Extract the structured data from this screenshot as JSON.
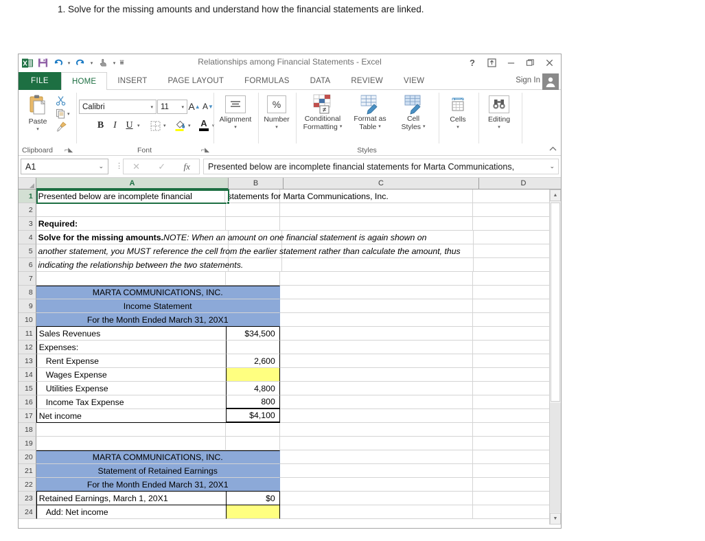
{
  "page": {
    "instruction": "1. Solve for the missing amounts and understand how the financial statements are linked."
  },
  "window": {
    "title": "Relationships among Financial Statements - Excel",
    "qat": [
      {
        "name": "excel-logo-icon",
        "glyph": "X"
      },
      {
        "name": "save-icon",
        "glyph": "💾"
      },
      {
        "name": "undo-icon",
        "glyph": "↶"
      },
      {
        "name": "redo-icon",
        "glyph": "↷"
      },
      {
        "name": "touch-mode-icon",
        "glyph": "☝"
      },
      {
        "name": "customize-qat-icon",
        "glyph": "⨍"
      }
    ],
    "controls": [
      {
        "name": "help-button",
        "glyph": "?"
      },
      {
        "name": "ribbon-display-options-button",
        "glyph": "⤒"
      },
      {
        "name": "minimize-button",
        "glyph": "—"
      },
      {
        "name": "restore-button",
        "glyph": "❐"
      },
      {
        "name": "close-button",
        "glyph": "✕"
      }
    ]
  },
  "ribbon": {
    "file_tab": "FILE",
    "tabs": [
      {
        "label": "HOME",
        "active": true
      },
      {
        "label": "INSERT",
        "active": false
      },
      {
        "label": "PAGE LAYOUT",
        "active": false
      },
      {
        "label": "FORMULAS",
        "active": false
      },
      {
        "label": "DATA",
        "active": false
      },
      {
        "label": "REVIEW",
        "active": false
      },
      {
        "label": "VIEW",
        "active": false
      }
    ],
    "sign_in": "Sign In",
    "groups": {
      "clipboard": {
        "label": "Clipboard",
        "paste": "Paste",
        "cut_icon": "scissors-icon",
        "copy_icon": "copy-icon",
        "format_painter_icon": "format-painter-icon"
      },
      "font": {
        "label": "Font",
        "font_name": "Calibri",
        "font_size": "11",
        "grow_font": "A",
        "shrink_font": "A",
        "bold": "B",
        "italic": "I",
        "underline": "U",
        "borders_icon": "borders-icon",
        "fill_color_icon": "fill-color-icon",
        "font_color": "A"
      },
      "alignment": {
        "label": "Alignment",
        "icon": "alignment-icon"
      },
      "number": {
        "label": "Number",
        "icon": "percent-icon",
        "glyph": "%"
      },
      "styles": {
        "label": "Styles",
        "conditional_formatting": "Conditional\nFormatting",
        "conditional_formatting_l1": "Conditional",
        "conditional_formatting_l2": "Formatting",
        "format_as_table_l1": "Format as",
        "format_as_table_l2": "Table",
        "cell_styles_l1": "Cell",
        "cell_styles_l2": "Styles"
      },
      "cells": {
        "label": "Cells",
        "icon": "cells-icon"
      },
      "editing": {
        "label": "Editing",
        "icon": "binoculars-icon"
      }
    },
    "collapse_icon": "chevron-up-icon"
  },
  "formula_bar": {
    "name_box_value": "A1",
    "cancel_icon": "cancel-icon",
    "enter_icon": "check-icon",
    "insert_function_icon": "fx-icon",
    "insert_function_label": "fx",
    "formula_value": "Presented below are incomplete financial statements for Marta Communications,",
    "expand_icon": "chevron-down-icon"
  },
  "grid": {
    "columns": [
      "A",
      "B",
      "C",
      "D"
    ],
    "selected_column": "A",
    "selected_row": 1,
    "rows": [
      {
        "n": 1,
        "cells": [
          {
            "col": "A",
            "text": "Presented below are incomplete financial",
            "overflow": true,
            "style": "plain"
          },
          {
            "col": "B",
            "text": "statements for Marta Communications, Inc.",
            "style": "overflowtext"
          },
          {
            "col": "C",
            "text": ""
          },
          {
            "col": "D",
            "text": ""
          }
        ]
      },
      {
        "n": 2,
        "cells": [
          {
            "col": "A",
            "text": ""
          },
          {
            "col": "B",
            "text": ""
          },
          {
            "col": "C",
            "text": ""
          },
          {
            "col": "D",
            "text": ""
          }
        ]
      },
      {
        "n": 3,
        "cells": [
          {
            "col": "A",
            "text": "Required:",
            "style": "bold"
          },
          {
            "col": "B",
            "text": ""
          },
          {
            "col": "C",
            "text": ""
          },
          {
            "col": "D",
            "text": ""
          }
        ]
      },
      {
        "n": 4,
        "cells": [
          {
            "col": "A",
            "text": "Solve for the missing amounts.",
            "text2": "  NOTE:  When an amount on one financial statement is again shown on",
            "style": "bold-then-italic",
            "overflow": true
          },
          {
            "col": "B",
            "text": ""
          },
          {
            "col": "C",
            "text": ""
          },
          {
            "col": "D",
            "text": ""
          }
        ]
      },
      {
        "n": 5,
        "cells": [
          {
            "col": "A",
            "text": "another statement, you MUST reference the cell from the earlier statement rather than calculate the amount, thus",
            "style": "italic",
            "overflow": true
          },
          {
            "col": "B",
            "text": ""
          },
          {
            "col": "C",
            "text": ""
          },
          {
            "col": "D",
            "text": ""
          }
        ]
      },
      {
        "n": 6,
        "cells": [
          {
            "col": "A",
            "text": "indicating the relationship between the two statements.",
            "style": "italic",
            "overflow": true
          },
          {
            "col": "B",
            "text": ""
          },
          {
            "col": "C",
            "text": ""
          },
          {
            "col": "D",
            "text": ""
          }
        ]
      },
      {
        "n": 7,
        "cells": [
          {
            "col": "A",
            "text": ""
          },
          {
            "col": "B",
            "text": ""
          },
          {
            "col": "C",
            "text": ""
          },
          {
            "col": "D",
            "text": ""
          }
        ]
      },
      {
        "n": 8,
        "cells": [
          {
            "col": "A",
            "text": "MARTA COMMUNICATIONS, INC.",
            "style": "blue-merged"
          },
          {
            "col": "C",
            "text": ""
          },
          {
            "col": "D",
            "text": ""
          }
        ]
      },
      {
        "n": 9,
        "cells": [
          {
            "col": "A",
            "text": "Income Statement",
            "style": "blue-merged"
          },
          {
            "col": "C",
            "text": ""
          },
          {
            "col": "D",
            "text": ""
          }
        ]
      },
      {
        "n": 10,
        "cells": [
          {
            "col": "A",
            "text": "For the Month Ended  March 31, 20X1",
            "style": "blue-merged"
          },
          {
            "col": "C",
            "text": ""
          },
          {
            "col": "D",
            "text": ""
          }
        ]
      },
      {
        "n": 11,
        "cells": [
          {
            "col": "A",
            "text": "Sales Revenues",
            "style": "boxed"
          },
          {
            "col": "B",
            "text": "$34,500",
            "style": "boxed-num"
          },
          {
            "col": "C",
            "text": ""
          },
          {
            "col": "D",
            "text": ""
          }
        ]
      },
      {
        "n": 12,
        "cells": [
          {
            "col": "A",
            "text": "Expenses:",
            "style": "boxed"
          },
          {
            "col": "B",
            "text": "",
            "style": "boxed-num"
          },
          {
            "col": "C",
            "text": ""
          },
          {
            "col": "D",
            "text": ""
          }
        ]
      },
      {
        "n": 13,
        "cells": [
          {
            "col": "A",
            "text": "Rent Expense",
            "style": "boxed-indent"
          },
          {
            "col": "B",
            "text": "2,600",
            "style": "boxed-num"
          },
          {
            "col": "C",
            "text": ""
          },
          {
            "col": "D",
            "text": ""
          }
        ]
      },
      {
        "n": 14,
        "cells": [
          {
            "col": "A",
            "text": "Wages Expense",
            "style": "boxed-indent"
          },
          {
            "col": "B",
            "text": "",
            "style": "boxed-num-yellow"
          },
          {
            "col": "C",
            "text": ""
          },
          {
            "col": "D",
            "text": ""
          }
        ]
      },
      {
        "n": 15,
        "cells": [
          {
            "col": "A",
            "text": "Utilities Expense",
            "style": "boxed-indent"
          },
          {
            "col": "B",
            "text": "4,800",
            "style": "boxed-num"
          },
          {
            "col": "C",
            "text": ""
          },
          {
            "col": "D",
            "text": ""
          }
        ]
      },
      {
        "n": 16,
        "cells": [
          {
            "col": "A",
            "text": "Income Tax Expense",
            "style": "boxed-indent"
          },
          {
            "col": "B",
            "text": "800",
            "style": "boxed-num-subtotal"
          },
          {
            "col": "C",
            "text": ""
          },
          {
            "col": "D",
            "text": ""
          }
        ]
      },
      {
        "n": 17,
        "cells": [
          {
            "col": "A",
            "text": "Net income",
            "style": "boxed"
          },
          {
            "col": "B",
            "text": "$4,100",
            "style": "boxed-num-total"
          },
          {
            "col": "C",
            "text": ""
          },
          {
            "col": "D",
            "text": ""
          }
        ]
      },
      {
        "n": 18,
        "cells": [
          {
            "col": "A",
            "text": ""
          },
          {
            "col": "B",
            "text": ""
          },
          {
            "col": "C",
            "text": ""
          },
          {
            "col": "D",
            "text": ""
          }
        ]
      },
      {
        "n": 19,
        "cells": [
          {
            "col": "A",
            "text": ""
          },
          {
            "col": "B",
            "text": ""
          },
          {
            "col": "C",
            "text": ""
          },
          {
            "col": "D",
            "text": ""
          }
        ]
      },
      {
        "n": 20,
        "cells": [
          {
            "col": "A",
            "text": "MARTA COMMUNICATIONS, INC.",
            "style": "blue-merged"
          },
          {
            "col": "C",
            "text": ""
          },
          {
            "col": "D",
            "text": ""
          }
        ]
      },
      {
        "n": 21,
        "cells": [
          {
            "col": "A",
            "text": "Statement of Retained Earnings",
            "style": "blue-merged"
          },
          {
            "col": "C",
            "text": ""
          },
          {
            "col": "D",
            "text": ""
          }
        ]
      },
      {
        "n": 22,
        "cells": [
          {
            "col": "A",
            "text": "For the Month Ended  March 31, 20X1",
            "style": "blue-merged"
          },
          {
            "col": "C",
            "text": ""
          },
          {
            "col": "D",
            "text": ""
          }
        ]
      },
      {
        "n": 23,
        "cells": [
          {
            "col": "A",
            "text": "Retained Earnings, March 1, 20X1",
            "style": "boxed"
          },
          {
            "col": "B",
            "text": "$0",
            "style": "boxed-num"
          },
          {
            "col": "C",
            "text": ""
          },
          {
            "col": "D",
            "text": ""
          }
        ]
      },
      {
        "n": 24,
        "cells": [
          {
            "col": "A",
            "text": "Add: Net income",
            "style": "boxed-indent"
          },
          {
            "col": "B",
            "text": "",
            "style": "boxed-num-yellow"
          },
          {
            "col": "C",
            "text": ""
          },
          {
            "col": "D",
            "text": ""
          }
        ]
      }
    ]
  },
  "scrollbar": {
    "up_arrow_icon": "triangle-up-icon",
    "down_arrow_icon": "triangle-down-icon",
    "thumb_name": "vertical-scroll-thumb"
  },
  "colors": {
    "header_blue": "#8CA9D8",
    "input_yellow": "#FFFF80",
    "excel_green": "#1D6F42",
    "grid_line": "#D4D4D4"
  }
}
